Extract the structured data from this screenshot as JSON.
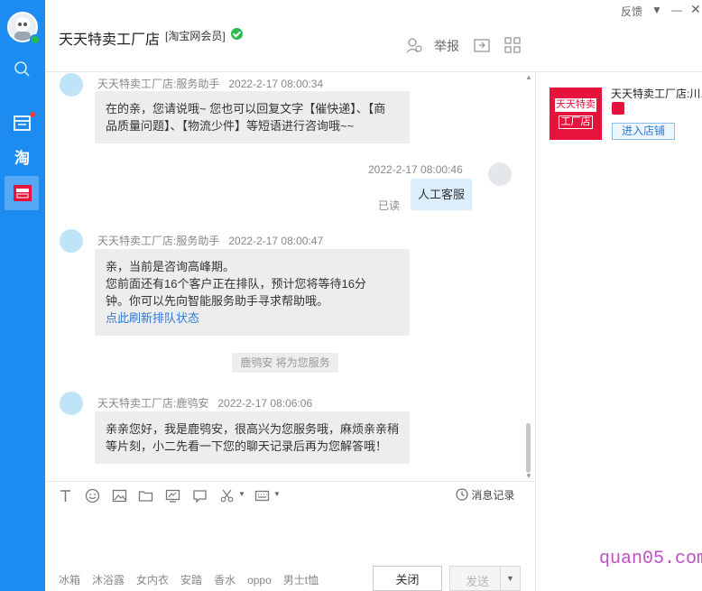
{
  "header": {
    "shop_title": "天天特卖工厂店",
    "member_badge": "[淘宝网会员]",
    "report_label": "举报",
    "feedback_label": "反馈"
  },
  "messages": [
    {
      "sender": "天天特卖工厂店:服务助手",
      "time": "2022-2-17 08:00:34",
      "lines": [
        "在的亲，您请说哦~ 您也可以回复文字【催快递】、【商",
        "品质量问题】、【物流少件】等短语进行咨询哦~~"
      ]
    },
    {
      "time": "2022-2-17 08:00:46",
      "text": "人工客服",
      "status": "已读"
    },
    {
      "sender": "天天特卖工厂店:服务助手",
      "time": "2022-2-17 08:00:47",
      "lines": [
        "亲，当前是咨询高峰期。",
        "您前面还有16个客户正在排队，预计您将等待16分",
        "钟。你可以先向智能服务助手寻求帮助哦。"
      ],
      "link": "点此刷新排队状态"
    },
    {
      "sender": "天天特卖工厂店:鹿鸮安",
      "time": "2022-2-17 08:06:06",
      "lines": [
        "亲亲您好，我是鹿鸮安，很高兴为您服务哦，麻烦亲亲稍",
        "等片刻，小二先看一下您的聊天记录后再为您解答哦！"
      ]
    }
  ],
  "system_note": "鹿鸮安 将为您服务",
  "toolbar": {
    "history_label": "消息记录"
  },
  "quick_phrases": [
    "冰箱",
    "沐浴露",
    "女内衣",
    "安踏",
    "香水",
    "oppo",
    "男士t恤"
  ],
  "buttons": {
    "close": "关闭",
    "send": "发送"
  },
  "side": {
    "shop_name": "天天特卖工厂店:川...",
    "logo_line1": "天天特卖",
    "logo_line2": "工厂店",
    "enter_label": "进入店铺"
  },
  "watermark": "quan05.com"
}
